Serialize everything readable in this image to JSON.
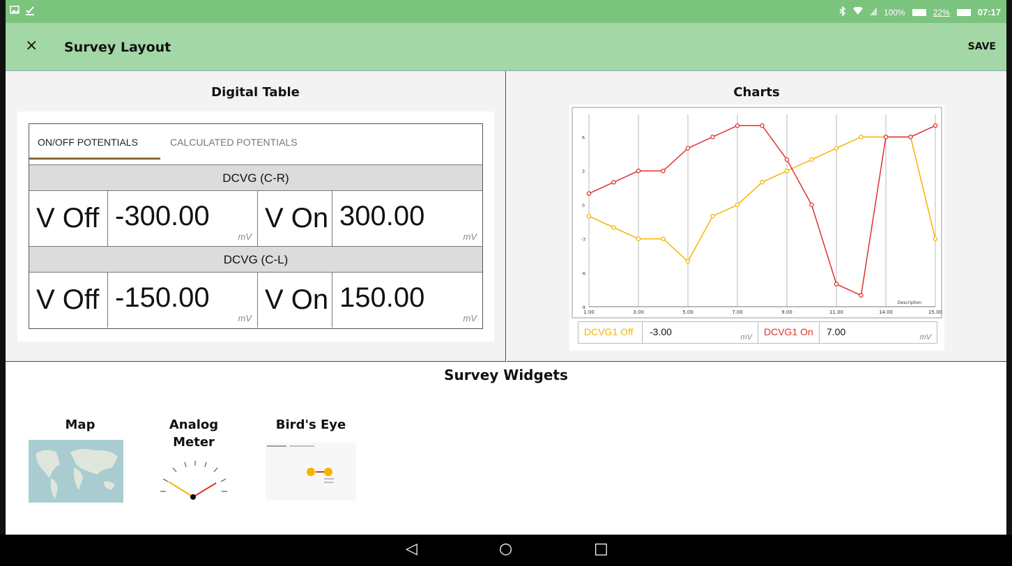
{
  "status_bar": {
    "battery_1": "100%",
    "battery_2": "22%",
    "time": "07:17"
  },
  "app_bar": {
    "close_glyph": "×",
    "title": "Survey Layout",
    "save_label": "SAVE"
  },
  "digital_table": {
    "heading": "Digital Table",
    "tabs": [
      "ON/OFF POTENTIALS",
      "CALCULATED POTENTIALS"
    ],
    "groups": [
      {
        "title": "DCVG (C-R)",
        "off_label": "V Off",
        "off_value": "-300.00",
        "on_label": "V On",
        "on_value": "300.00",
        "unit": "mV"
      },
      {
        "title": "DCVG (C-L)",
        "off_label": "V Off",
        "off_value": "-150.00",
        "on_label": "V On",
        "on_value": "150.00",
        "unit": "mV"
      }
    ]
  },
  "charts": {
    "heading": "Charts",
    "footer": {
      "off_label": "DCVG1 Off",
      "off_value": "-3.00",
      "on_label": "DCVG1 On",
      "on_value": "7.00",
      "unit": "mV"
    }
  },
  "chart_data": {
    "type": "line",
    "x": [
      1,
      2,
      3,
      4,
      5,
      6,
      7,
      8,
      9,
      10,
      11,
      12,
      13,
      14,
      15
    ],
    "x_tick_labels": [
      "1.00",
      "3.00",
      "5.00",
      "7.00",
      "9.00",
      "11.00",
      "14.00",
      "15.00"
    ],
    "y_tick_labels": [
      "6",
      "3",
      "0",
      "-3",
      "-6",
      "-9"
    ],
    "ylim": [
      -9,
      8
    ],
    "annotation": "Description",
    "series": [
      {
        "name": "DCVG1 Off",
        "color": "#f5b400",
        "values": [
          -1,
          -2,
          -3,
          -3,
          -5,
          -1,
          0,
          2,
          3,
          4,
          5,
          6,
          6,
          6,
          -3
        ]
      },
      {
        "name": "DCVG1 On",
        "color": "#e03030",
        "values": [
          1,
          2,
          3,
          3,
          5,
          6,
          7,
          7,
          4,
          0,
          -7,
          -8,
          6,
          6,
          7
        ]
      }
    ]
  },
  "survey_widgets": {
    "heading": "Survey Widgets",
    "items": [
      {
        "label": "Map"
      },
      {
        "label": "Analog\nMeter"
      },
      {
        "label": "Bird's Eye"
      }
    ]
  },
  "nav": {
    "back": "◁",
    "home": "○",
    "recents": "□"
  },
  "colors": {
    "status_bar": "#7bc47e",
    "app_bar": "#a4d7a6",
    "off_series": "#f5b400",
    "on_series": "#e03030"
  }
}
